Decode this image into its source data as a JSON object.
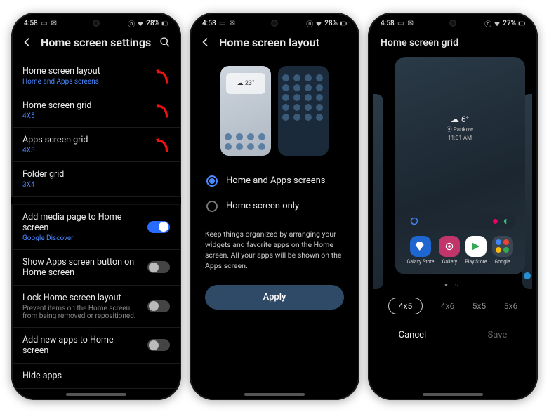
{
  "phone1": {
    "status": {
      "time": "4:58",
      "battery": "28%"
    },
    "header": {
      "title": "Home screen settings"
    },
    "items": [
      {
        "title": "Home screen layout",
        "sub": "Home and Apps screens",
        "subClass": "blue",
        "arrow": true
      },
      {
        "title": "Home screen grid",
        "sub": "4X5",
        "subClass": "blue",
        "arrow": true
      },
      {
        "title": "Apps screen grid",
        "sub": "4X5",
        "subClass": "blue",
        "arrow": true
      },
      {
        "title": "Folder grid",
        "sub": "3X4",
        "subClass": "blue",
        "arrow": false
      },
      {
        "gap": true
      },
      {
        "title": "Add media page to Home screen",
        "sub": "Google Discover",
        "subClass": "blue",
        "toggle": true,
        "on": true
      },
      {
        "title": "Show Apps screen button on Home screen",
        "toggle": true,
        "on": false
      },
      {
        "title": "Lock Home screen layout",
        "sub": "Prevent items on the Home screen from being removed or repositioned.",
        "subClass": "gray",
        "toggle": true,
        "on": false
      },
      {
        "title": "Add new apps to Home screen",
        "toggle": true,
        "on": false
      },
      {
        "title": "Hide apps"
      }
    ]
  },
  "phone2": {
    "status": {
      "time": "4:58",
      "battery": "28%"
    },
    "header": {
      "title": "Home screen layout"
    },
    "mini_widget": "☁ 23°",
    "options": [
      {
        "label": "Home and Apps screens",
        "selected": true
      },
      {
        "label": "Home screen only",
        "selected": false
      }
    ],
    "desc": "Keep things organized by arranging your widgets and favorite apps on the Home screen. All your apps will be shown on the Apps screen.",
    "apply": "Apply"
  },
  "phone3": {
    "status": {
      "time": "4:58",
      "battery": "27%"
    },
    "title": "Home screen grid",
    "weather": {
      "temp": "☁ 6°",
      "loc": "⦿ Pankow",
      "time2": "11:01 AM"
    },
    "apps": [
      {
        "name": "Galaxy Store",
        "color": "blue"
      },
      {
        "name": "Gallery",
        "color": "pink"
      },
      {
        "name": "Play Store",
        "color": "white"
      },
      {
        "name": "Google",
        "color": "folder"
      }
    ],
    "grid_options": [
      "4x5",
      "4x6",
      "5x5",
      "5x6"
    ],
    "selected_grid": "4x5",
    "cancel": "Cancel",
    "save": "Save"
  }
}
